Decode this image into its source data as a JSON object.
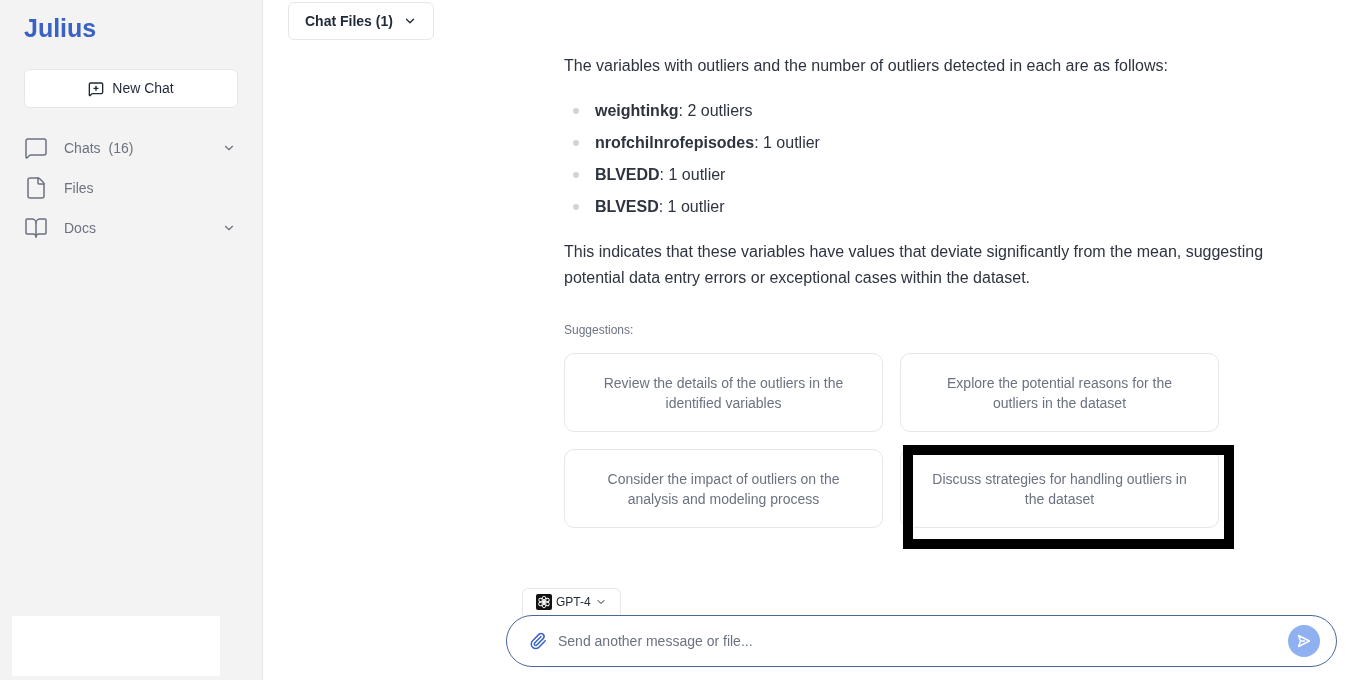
{
  "sidebar": {
    "logo": "Julius",
    "new_chat": "New Chat",
    "items": [
      {
        "kind": "chats",
        "label": "Chats",
        "count": "(16)",
        "expandable": true
      },
      {
        "kind": "files",
        "label": "Files",
        "expandable": false
      },
      {
        "kind": "docs",
        "label": "Docs",
        "expandable": true
      }
    ]
  },
  "header": {
    "chat_files": "Chat Files (1)"
  },
  "message": {
    "intro": "The variables with outliers and the number of outliers detected in each are as follows:",
    "outliers": [
      "**weightinkg**: 2 outliers",
      "**nrofchilnrofepisodes**: 1 outlier",
      "**BLVEDD**: 1 outlier",
      "**BLVESD**: 1 outlier"
    ],
    "conclusion": "This indicates that these variables have values that deviate significantly from the mean, suggesting potential data entry errors or exceptional cases within the dataset."
  },
  "suggestions": {
    "label": "Suggestions:",
    "items": [
      {
        "text": "Review the details of the outliers in the identified variables",
        "highlighted": false
      },
      {
        "text": "Explore the potential reasons for the outliers in the dataset",
        "highlighted": false
      },
      {
        "text": "Consider the impact of outliers on the analysis and modeling process",
        "highlighted": false
      },
      {
        "text": "Discuss strategies for handling outliers in the dataset",
        "highlighted": true
      }
    ]
  },
  "composer": {
    "model": "GPT-4",
    "placeholder": "Send another message or file..."
  }
}
